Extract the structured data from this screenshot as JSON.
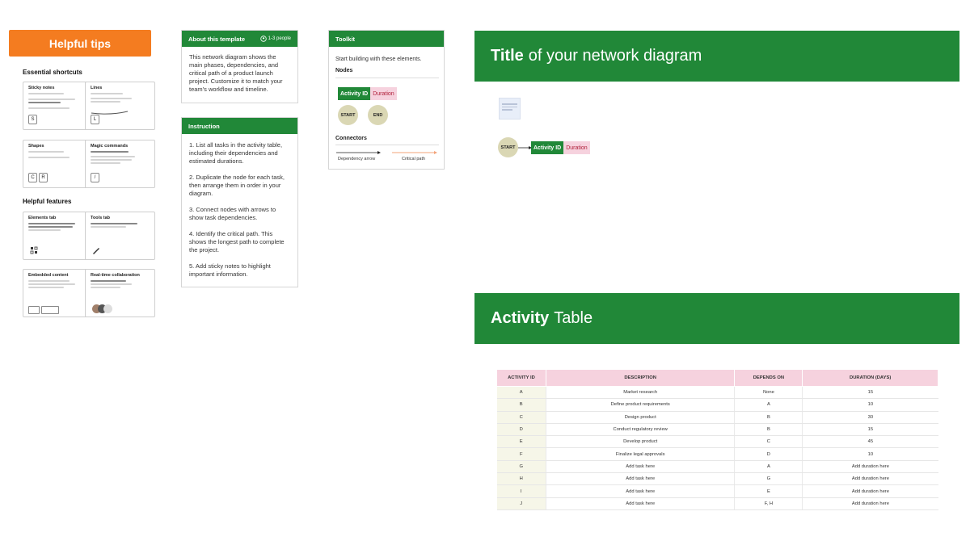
{
  "helpful_tips": {
    "title": "Helpful tips",
    "essential_shortcuts_heading": "Essential shortcuts",
    "helpful_features_heading": "Helpful features",
    "shortcuts": [
      {
        "title": "Sticky notes",
        "keys": [
          "S"
        ]
      },
      {
        "title": "Lines",
        "keys": [
          "L"
        ]
      },
      {
        "title": "Shapes",
        "keys": [
          "C",
          "R"
        ]
      },
      {
        "title": "Magic commands",
        "keys": [
          "/"
        ]
      }
    ],
    "features": [
      {
        "title": "Elements tab"
      },
      {
        "title": "Tools tab"
      },
      {
        "title": "Embedded content"
      },
      {
        "title": "Real-time collaboration"
      }
    ]
  },
  "about": {
    "title": "About this template",
    "people": "1-3 people",
    "text": "This network diagram shows the main phases, dependencies, and critical path of a product launch project. Customize it to match your team's workflow and timeline."
  },
  "instruction": {
    "title": "Instruction",
    "steps": [
      "1. List all tasks in the activity table, including their dependencies and estimated durations.",
      "2. Duplicate the node for each task, then arrange them in order in your diagram.",
      "3. Connect nodes with arrows to show task dependencies.",
      "4. Identify the critical path. This shows the longest path to complete the project.",
      "5. Add sticky notes to highlight important information."
    ]
  },
  "toolkit": {
    "title": "Toolkit",
    "intro": "Start building with these elements.",
    "nodes_heading": "Nodes",
    "activity_id": "Activity ID",
    "duration": "Duration",
    "start": "START",
    "end": "END",
    "connectors_heading": "Connectors",
    "dependency_arrow": "Dependency arrow",
    "critical_path": "Critical path"
  },
  "diagram": {
    "title_bold": "Title",
    "title_rest": "of your network diagram",
    "start": "START",
    "activity_id": "Activity ID",
    "duration": "Duration"
  },
  "activity_table": {
    "title_bold": "Activity",
    "title_rest": "Table",
    "headers": [
      "ACTIVITY ID",
      "DESCRIPTION",
      "DEPENDS ON",
      "DURATION (DAYS)"
    ],
    "rows": [
      [
        "A",
        "Market research",
        "None",
        "15"
      ],
      [
        "B",
        "Define product requirements",
        "A",
        "10"
      ],
      [
        "C",
        "Design product",
        "B",
        "30"
      ],
      [
        "D",
        "Conduct regulatory review",
        "B",
        "15"
      ],
      [
        "E",
        "Develop product",
        "C",
        "45"
      ],
      [
        "F",
        "Finalize legal approvals",
        "D",
        "10"
      ],
      [
        "G",
        "Add task here",
        "A",
        "Add duration here"
      ],
      [
        "H",
        "Add task here",
        "G",
        "Add duration here"
      ],
      [
        "I",
        "Add task here",
        "E",
        "Add duration here"
      ],
      [
        "J",
        "Add task here",
        "F, H",
        "Add duration here"
      ]
    ]
  },
  "colors": {
    "green": "#218838",
    "orange": "#f47c20",
    "pink": "#f6d2de",
    "node_circle": "#dad7b4"
  }
}
